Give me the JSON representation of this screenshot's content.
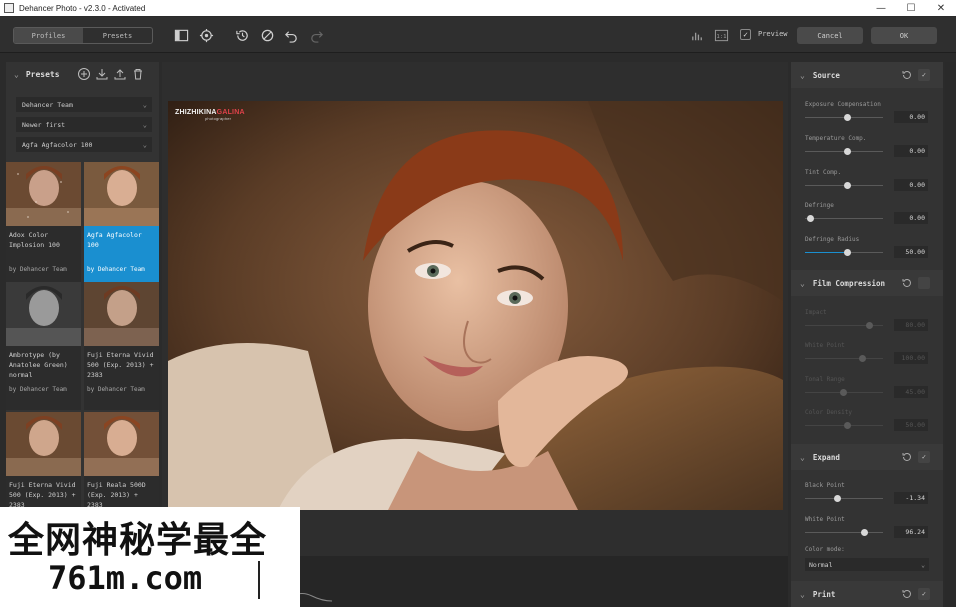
{
  "window": {
    "title": "Dehancer Photo - v2.3.0 - Activated",
    "minimize_glyph": "—",
    "maximize_glyph": "☐",
    "close_glyph": "✕"
  },
  "toolbar": {
    "tabs": [
      {
        "label": "Profiles",
        "active": true
      },
      {
        "label": "Presets",
        "active": false
      }
    ],
    "icons": [
      "split-view-icon",
      "settings-icon",
      "history-icon",
      "reset-icon",
      "undo-icon",
      "redo-icon",
      "histogram-icon",
      "one-to-one-icon"
    ],
    "one_to_one_label": "1:1",
    "preview_label": "Preview",
    "preview_checked": true,
    "cancel_label": "Cancel",
    "ok_label": "OK"
  },
  "left_panel": {
    "title": "Presets",
    "filters": [
      {
        "label": "Dehancer Team"
      },
      {
        "label": "Newer first"
      },
      {
        "label": "Agfa Agfacolor 100"
      }
    ],
    "presets": [
      {
        "name": "Adox Color Implosion 100",
        "author": "by Dehancer Team",
        "selected": false
      },
      {
        "name": "Agfa Agfacolor 100",
        "author": "by Dehancer Team",
        "selected": true
      },
      {
        "name": "Ambrotype (by Anatolee Green) normal",
        "author": "by Dehancer Team",
        "selected": false
      },
      {
        "name": "Fuji Eterna Vivid 500 (Exp. 2013) + 2383",
        "author": "by Dehancer Team",
        "selected": false
      },
      {
        "name": "Fuji Eterna Vivid 500 (Exp. 2013) + 2383",
        "author": "",
        "selected": false
      },
      {
        "name": "Fuji Reala 500D (Exp. 2013) + 2383",
        "author": "",
        "selected": false
      }
    ]
  },
  "image": {
    "watermark_main": "ZHIZHIKINA",
    "watermark_accent": "GALINA",
    "watermark_sub": "photographer"
  },
  "right_panel": {
    "sections": [
      {
        "title": "Source",
        "params": [
          {
            "label": "Exposure Compensation",
            "value": "0.00",
            "level": 0.5
          },
          {
            "label": "Temperature Comp.",
            "value": "0.00",
            "level": 0.5
          },
          {
            "label": "Tint Comp.",
            "value": "0.00",
            "level": 0.5
          },
          {
            "label": "Defringe",
            "value": "0.00",
            "level": 0.0
          },
          {
            "label": "Defringe Radius",
            "value": "50.00",
            "level": 0.5
          }
        ]
      },
      {
        "title": "Film Compression",
        "params": [
          {
            "label": "Impact",
            "value": "80.00",
            "level": 0.8
          },
          {
            "label": "White Point",
            "value": "100.00",
            "level": 0.7
          },
          {
            "label": "Tonal Range",
            "value": "45.00",
            "level": 0.45
          },
          {
            "label": "Color Density",
            "value": "50.00",
            "level": 0.5
          }
        ]
      },
      {
        "title": "Expand",
        "params": [
          {
            "label": "Black Point",
            "value": "-1.34",
            "level": 0.37
          },
          {
            "label": "White Point",
            "value": "96.24",
            "level": 0.65
          }
        ],
        "color_mode_label": "Color mode:",
        "color_mode_value": "Normal"
      },
      {
        "title": "Print"
      }
    ]
  },
  "site_watermark": {
    "line1": "全网神秘学最全",
    "line2": "761m.com"
  },
  "colors": {
    "accent": "#1a8fd0",
    "panel": "#333333",
    "background": "#2b2b2b"
  }
}
